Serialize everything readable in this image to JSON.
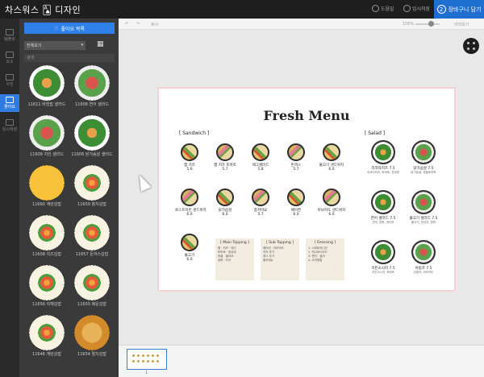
{
  "topbar": {
    "logo": "차스워스 🂡 디자인",
    "help": "도움말",
    "save": "임시저장",
    "cart_num": "2",
    "cart_label": "장바구니 담기"
  },
  "leftnav": [
    {
      "label": "템플릿"
    },
    {
      "label": "요소"
    },
    {
      "label": "사진"
    },
    {
      "label": "좋아요",
      "active": true
    },
    {
      "label": "임시저장"
    }
  ],
  "panel": {
    "fav_label": "좋아요 목록",
    "category": "전체보기",
    "search_placeholder": "검색"
  },
  "thumbs": [
    {
      "label": "11611 비빔밥 샐러드",
      "style": "bowl"
    },
    {
      "label": "11608 연어 샐러드",
      "style": "bowl2"
    },
    {
      "label": "11609 치킨 샐러드",
      "style": "bowl2"
    },
    {
      "label": "11606 닭가슴살 샐러드",
      "style": "bowl"
    },
    {
      "label": "11660 계란김밥",
      "style": "egg"
    },
    {
      "label": "11659 참치김밥",
      "style": "gimbap"
    },
    {
      "label": "11658 치즈김밥",
      "style": "gimbap"
    },
    {
      "label": "11657 돈까스김밥",
      "style": "gimbap"
    },
    {
      "label": "11656 야채김밥",
      "style": "gimbap"
    },
    {
      "label": "11655 매운김밥",
      "style": "gimbap"
    },
    {
      "label": "11646 계란김밥",
      "style": "gimbap"
    },
    {
      "label": "11654 멸치김밥",
      "style": "fried"
    }
  ],
  "toolbar": {
    "undo": "↶",
    "redo": "↷",
    "copy": "복사",
    "zoom": "100%",
    "preview": "미리보기"
  },
  "menu": {
    "title": "Fresh Menu",
    "sandwich_header": "[ Sandwich ]",
    "salad_header": "[ Salad ]",
    "sandwiches": [
      {
        "name": "햄 치즈",
        "price": "5.6"
      },
      {
        "name": "햄 치즈 토마토",
        "price": "5.7"
      },
      {
        "name": "에그샐러드",
        "price": "5.8"
      },
      {
        "name": "돈까스",
        "price": "5.7"
      },
      {
        "name": "불고기 샌드위치",
        "price": "6.0"
      },
      {
        "name": "로스트치킨 샌드위치",
        "price": "6.0"
      },
      {
        "name": "닭가슴살",
        "price": "6.0"
      },
      {
        "name": "참치마요",
        "price": "5.7"
      },
      {
        "name": "베이컨",
        "price": "6.0"
      },
      {
        "name": "아보카도 샌드위치",
        "price": "6.0"
      },
      {
        "name": "불고기",
        "price": "6.0"
      }
    ],
    "salads": [
      {
        "name": "리코타치즈 7.5",
        "desc": "리코타치즈, 토마토, 견과류"
      },
      {
        "name": "닭가슴살 7.5",
        "desc": "닭가슴살, 방울토마토"
      },
      {
        "name": "연어 샐러드 7.5",
        "desc": "연어, 양파, 케이퍼"
      },
      {
        "name": "불고기 샐러드 7.5",
        "desc": "불고기, 양상추, 양파"
      },
      {
        "name": "치킨소시지 7.5",
        "desc": "치킨소시지, 토마토"
      },
      {
        "name": "쉬림프 7.5",
        "desc": "쉬림프, 아보카도"
      }
    ],
    "boxes": [
      {
        "title": "[ Main Topping ]",
        "lines": [
          "햄 · 치즈 · 에그",
          "토마토 · 양상추",
          "피클 · 올리브",
          "양파 · 오이"
        ]
      },
      {
        "title": "[ Sub Topping ]",
        "lines": [
          "베이컨 · 아보카도",
          "치즈 추가",
          "에그 추가",
          "할라피뇨"
        ]
      },
      {
        "title": "[ Dressing ]",
        "lines": [
          "1. 스위트어니언",
          "2. 허니머스타드",
          "3. 랜치 · 칠리",
          "4. 오리엔탈"
        ]
      }
    ]
  },
  "pages": {
    "page_num": "1"
  }
}
